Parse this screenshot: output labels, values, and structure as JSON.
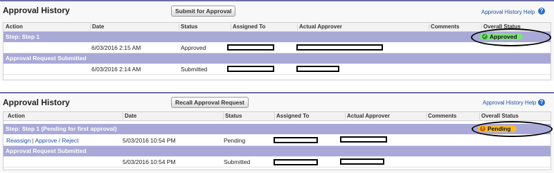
{
  "colors": {
    "panel_border": "#6c6ca8",
    "step_row": "#a9a9d8",
    "approved_badge": "#7ee07e",
    "pending_badge": "#f5b82e",
    "link": "#1a4f9e"
  },
  "panel1": {
    "title": "Approval History",
    "button_label": "Submit for Approval",
    "help_link": "Approval History Help",
    "help_icon": "?",
    "columns": [
      "Action",
      "Date",
      "Status",
      "Assigned To",
      "Actual Approver",
      "Comments",
      "Overall Status"
    ],
    "step_row": {
      "label": "Step: Step 1",
      "overall_status": "Approved",
      "status_icon": "✓"
    },
    "row1": {
      "action": "",
      "date": "6/03/2016 2:15 AM",
      "status": "Approved"
    },
    "submitted_row": {
      "label": "Approval Request Submitted"
    },
    "row2": {
      "action": "",
      "date": "6/03/2016 2:14 AM",
      "status": "Submitted"
    }
  },
  "panel2": {
    "title": "Approval History",
    "button_label": "Recall Approval Request",
    "help_link": "Approval History Help",
    "help_icon": "?",
    "columns": [
      "Action",
      "Date",
      "Status",
      "Assigned To",
      "Actual Approver",
      "Comments",
      "Overall Status"
    ],
    "step_row": {
      "label": "Step: Step 1 (Pending for first approval)",
      "overall_status": "Pending",
      "status_icon": "!"
    },
    "row1": {
      "actions": [
        "Reassign",
        "Approve / Reject"
      ],
      "separator": "|",
      "date": "5/03/2016 10:54 PM",
      "status": "Pending"
    },
    "submitted_row": {
      "label": "Approval Request Submitted"
    },
    "row2": {
      "action": "",
      "date": "5/03/2016 10:54 PM",
      "status": "Submitted"
    }
  }
}
